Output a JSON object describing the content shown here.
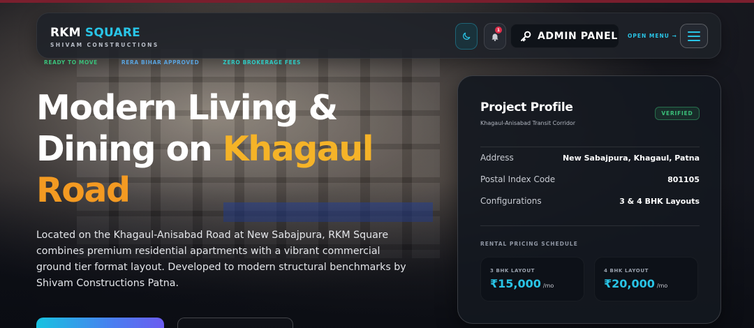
{
  "header": {
    "brand_primary": "RKM",
    "brand_accent": "SQUARE",
    "brand_tagline": "SHIVAM CONSTRUCTIONS",
    "notification_count": "1",
    "admin_label": "ADMIN PANEL",
    "open_menu_label": "OPEN MENU →"
  },
  "tags": [
    "READY TO MOVE",
    "RERA BIHAR APPROVED",
    "ZERO BROKERAGE FEES"
  ],
  "hero": {
    "title_line1": "Modern Living &",
    "title_line2_a": "Dining on ",
    "title_line2_b": "Khagaul",
    "title_line3": "Road",
    "description": "Located on the Khagaul-Anisabad Road at New Sabajpura, RKM Square combines premium residential apartments with a vibrant commercial ground tier format layout. Developed to modern structural benchmarks by Shivam Constructions Patna."
  },
  "profile": {
    "title": "Project Profile",
    "subtitle": "Khagaul-Anisabad Transit Corridor",
    "badge": "VERIFIED",
    "rows": [
      {
        "label": "Address",
        "value": "New Sabajpura, Khagaul, Patna"
      },
      {
        "label": "Postal Index Code",
        "value": "801105"
      },
      {
        "label": "Configurations",
        "value": "3 & 4 BHK Layouts"
      }
    ],
    "schedule_label": "RENTAL PRICING SCHEDULE",
    "prices": [
      {
        "caption": "3 BHK LAYOUT",
        "value": "₹15,000",
        "unit": "/mo"
      },
      {
        "caption": "4 BHK LAYOUT",
        "value": "₹20,000",
        "unit": "/mo"
      }
    ]
  },
  "icons": {
    "theme": "moon-icon",
    "notifications": "bell-icon",
    "admin": "key-icon",
    "menu": "hamburger-icon"
  },
  "colors": {
    "accent_cyan": "#29c4e6",
    "highlight_gold": "#f5b328",
    "highlight_orange": "#f39a22",
    "verified_green": "#3bc07a"
  }
}
